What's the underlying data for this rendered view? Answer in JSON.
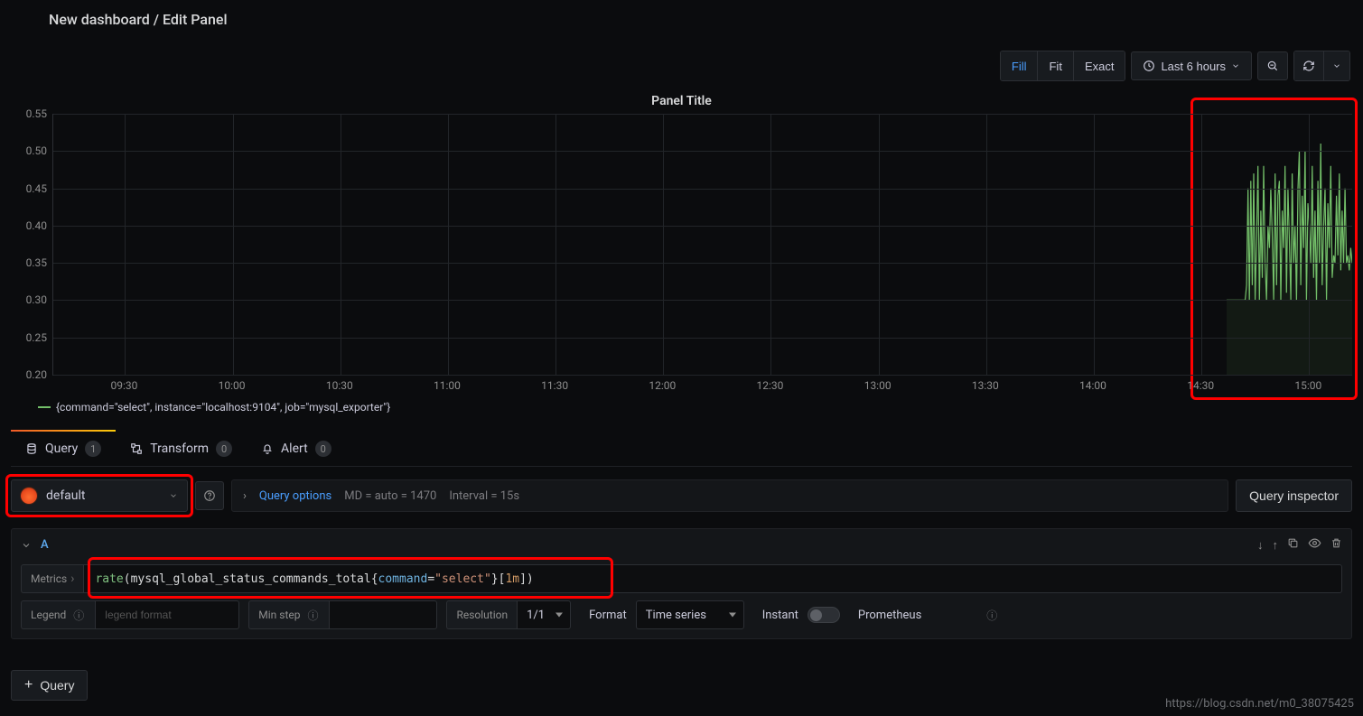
{
  "header": {
    "title": "New dashboard / Edit Panel"
  },
  "toolbar": {
    "fill": "Fill",
    "fit": "Fit",
    "exact": "Exact",
    "timerange": "Last 6 hours"
  },
  "panel": {
    "title": "Panel Title",
    "legend": "{command=\"select\", instance=\"localhost:9104\", job=\"mysql_exporter\"}"
  },
  "chart_data": {
    "type": "line",
    "title": "Panel Title",
    "xlabel": "",
    "ylabel": "",
    "ylim": [
      0.2,
      0.55
    ],
    "y_ticks": [
      0.2,
      0.25,
      0.3,
      0.35,
      0.4,
      0.45,
      0.5,
      0.55
    ],
    "x_ticks": [
      "09:30",
      "10:00",
      "10:30",
      "11:00",
      "11:30",
      "12:00",
      "12:30",
      "13:00",
      "13:30",
      "14:00",
      "14:30",
      "15:00"
    ],
    "series": [
      {
        "name": "{command=\"select\", instance=\"localhost:9104\", job=\"mysql_exporter\"}",
        "color": "#73bf69",
        "x_start": "14:37",
        "values": [
          0.3,
          0.3,
          0.3,
          0.3,
          0.3,
          0.3,
          0.3,
          0.3,
          0.3,
          0.3,
          0.3,
          0.3,
          0.3,
          0.3,
          0.32,
          0.45,
          0.3,
          0.46,
          0.32,
          0.47,
          0.3,
          0.38,
          0.48,
          0.3,
          0.42,
          0.33,
          0.48,
          0.35,
          0.3,
          0.4,
          0.37,
          0.45,
          0.39,
          0.3,
          0.47,
          0.32,
          0.44,
          0.46,
          0.3,
          0.42,
          0.37,
          0.48,
          0.31,
          0.45,
          0.38,
          0.3,
          0.47,
          0.35,
          0.4,
          0.3,
          0.45,
          0.5,
          0.32,
          0.44,
          0.37,
          0.5,
          0.3,
          0.43,
          0.4,
          0.35,
          0.48,
          0.33,
          0.42,
          0.3,
          0.46,
          0.35,
          0.51,
          0.32,
          0.4,
          0.45,
          0.3,
          0.43,
          0.37,
          0.48,
          0.33,
          0.36,
          0.35,
          0.44,
          0.36,
          0.47,
          0.34,
          0.42,
          0.35,
          0.45,
          0.35,
          0.36,
          0.34,
          0.37,
          0.35
        ]
      }
    ]
  },
  "tabs": {
    "query": "Query",
    "query_count": "1",
    "transform": "Transform",
    "transform_count": "0",
    "alert": "Alert",
    "alert_count": "0"
  },
  "query_options": {
    "datasource": "default",
    "link": "Query options",
    "md": "MD = auto = 1470",
    "interval": "Interval = 15s",
    "inspector": "Query inspector"
  },
  "query_row": {
    "label": "A",
    "metrics_label": "Metrics",
    "expr": {
      "func": "rate",
      "metric": "mysql_global_status_commands_total",
      "label_key": "command",
      "label_val": "\"select\"",
      "range": "1m"
    },
    "legend_label": "Legend",
    "legend_placeholder": "legend format",
    "minstep_label": "Min step",
    "resolution_label": "Resolution",
    "resolution_value": "1/1",
    "format_label": "Format",
    "format_value": "Time series",
    "instant_label": "Instant",
    "prometheus_label": "Prometheus"
  },
  "add_query": "Query",
  "watermark": "https://blog.csdn.net/m0_38075425"
}
